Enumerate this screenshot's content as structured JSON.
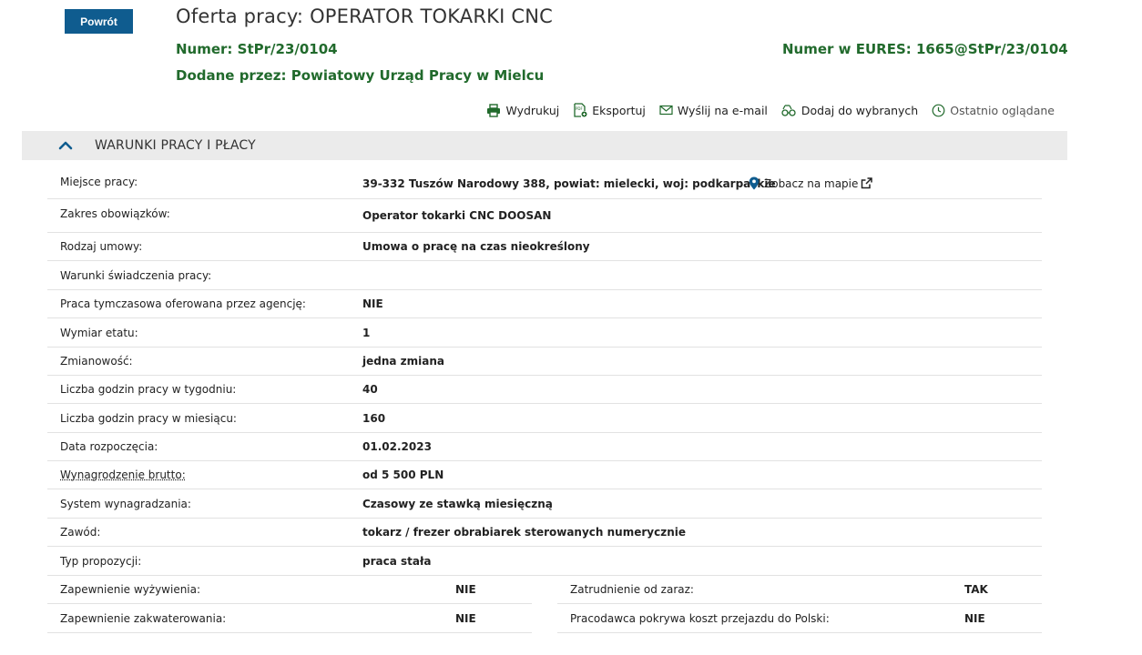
{
  "header": {
    "back_label": "Powrót",
    "title": "Oferta pracy: OPERATOR TOKARKI CNC",
    "number_label": "Numer:",
    "number_value": "StPr/23/0104",
    "eures_label": "Numer w EURES:",
    "eures_value": "1665@StPr/23/0104",
    "added_by_label": "Dodane przez:",
    "added_by_value": "Powiatowy Urząd Pracy w Mielcu"
  },
  "actions": {
    "print": "Wydrukuj",
    "export": "Eksportuj",
    "email": "Wyślij na e-mail",
    "add_favorite": "Dodaj do wybranych",
    "recently_viewed": "Ostatnio oglądane"
  },
  "section": {
    "title": "WARUNKI PRACY I PŁACY",
    "map_link": "Zobacz na mapie",
    "rows": [
      {
        "label": "Miejsce pracy:",
        "value": "39-332 Tuszów Narodowy 388, powiat: mielecki, woj: podkarpackie"
      },
      {
        "label": "Zakres obowiązków:",
        "value": "Operator tokarki CNC DOOSAN"
      },
      {
        "label": "Rodzaj umowy:",
        "value": "Umowa o pracę na czas nieokreślony"
      },
      {
        "label": "Warunki świadczenia pracy:",
        "value": ""
      },
      {
        "label": "Praca tymczasowa oferowana przez agencję:",
        "value": "NIE"
      },
      {
        "label": "Wymiar etatu:",
        "value": "1"
      },
      {
        "label": "Zmianowość:",
        "value": "jedna zmiana"
      },
      {
        "label": "Liczba godzin pracy w tygodniu:",
        "value": "40"
      },
      {
        "label": "Liczba godzin pracy w miesiącu:",
        "value": "160"
      },
      {
        "label": "Data rozpoczęcia:",
        "value": "01.02.2023"
      },
      {
        "label": "Wynagrodzenie brutto:",
        "value": "od 5 500 PLN"
      },
      {
        "label": "System wynagradzania:",
        "value": "Czasowy ze stawką miesięczną"
      },
      {
        "label": "Zawód:",
        "value": "tokarz / frezer obrabiarek sterowanych numerycznie"
      },
      {
        "label": "Typ propozycji:",
        "value": "praca stała"
      }
    ],
    "left_col": [
      {
        "label": "Zapewnienie wyżywienia:",
        "value": "NIE"
      },
      {
        "label": "Zapewnienie zakwaterowania:",
        "value": "NIE"
      }
    ],
    "right_col": [
      {
        "label": "Zatrudnienie od zaraz:",
        "value": "TAK"
      },
      {
        "label": "Pracodawca pokrywa koszt przejazdu do Polski:",
        "value": "NIE"
      }
    ]
  },
  "colors": {
    "brand_blue": "#0f5c8f",
    "green": "#216a2c",
    "section_bg": "#ebebeb"
  }
}
